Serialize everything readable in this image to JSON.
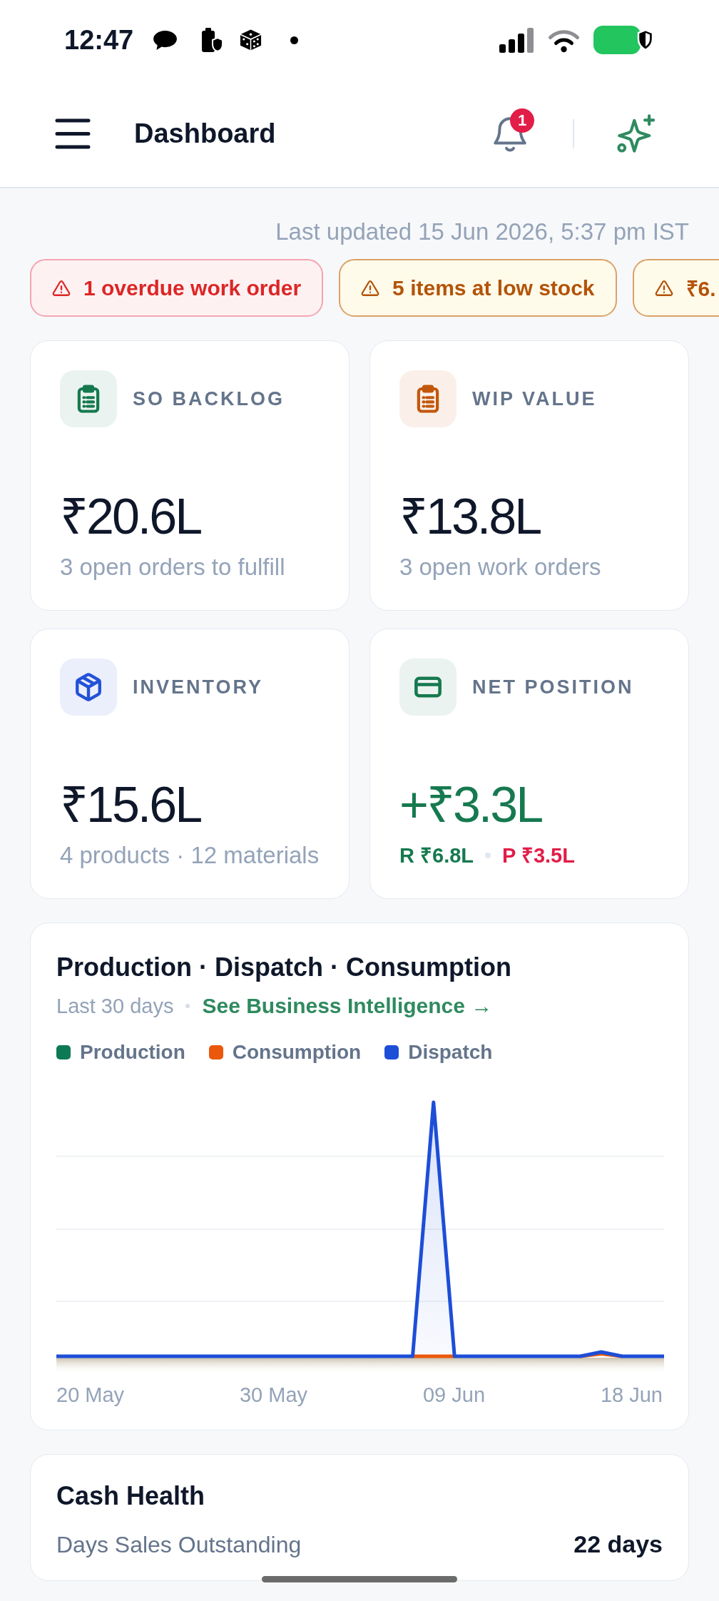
{
  "status_bar": {
    "time": "12:47"
  },
  "header": {
    "title": "Dashboard",
    "notifications": "1"
  },
  "last_updated": "Last updated 15 Jun 2026, 5:37 pm IST",
  "alerts": [
    {
      "kind": "danger",
      "text": "1 overdue work order"
    },
    {
      "kind": "warning",
      "text": "5 items at low stock"
    },
    {
      "kind": "warning",
      "text": "₹6."
    }
  ],
  "cards": [
    {
      "kind": "orders",
      "label": "SO BACKLOG",
      "color": "#15794f",
      "value": "₹20.6L",
      "positive": false,
      "note": "3 open orders to fulfill"
    },
    {
      "kind": "orders",
      "label": "WIP VALUE",
      "color": "#c2570c",
      "value": "₹13.8L",
      "positive": false,
      "note": "3 open work orders"
    },
    {
      "kind": "stock",
      "label": "INVENTORY",
      "color": "#2352d8",
      "value": "₹15.6L",
      "positive": false,
      "note": "4 products · 12 materials"
    },
    {
      "kind": "cash",
      "label": "NET POSITION",
      "color": "#16794f",
      "value": "+₹3.3L",
      "positive": true,
      "breakdown": [
        {
          "text": "R ₹6.8L",
          "color": "#16794f"
        },
        {
          "text": "P ₹3.5L",
          "color": "#e11d48"
        }
      ]
    }
  ],
  "chart": {
    "title": "Production · Dispatch · Consumption",
    "period": "Last 30 days",
    "link": "See Business Intelligence →",
    "legend": [
      {
        "label": "Production",
        "color": "#0e7a55"
      },
      {
        "label": "Consumption",
        "color": "#ea580c"
      },
      {
        "label": "Dispatch",
        "color": "#1d4ed8"
      }
    ],
    "x_labels": [
      "20 May",
      "30 May",
      "09 Jun",
      "18 Jun"
    ]
  },
  "cash_health": {
    "title": "Cash Health",
    "rows": [
      {
        "label": "Days Sales Outstanding",
        "value": "22 days"
      }
    ]
  }
}
